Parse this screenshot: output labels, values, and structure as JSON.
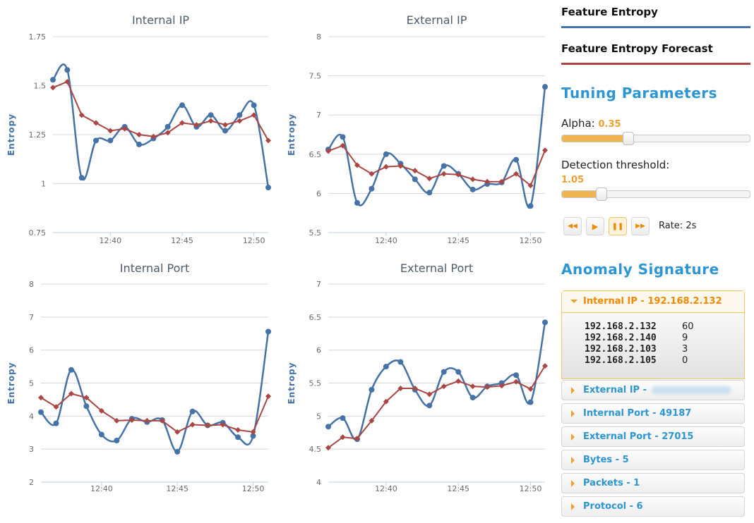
{
  "chart_data": [
    {
      "type": "line",
      "title": "Internal IP",
      "ylabel": "Entropy",
      "ylim": [
        0.75,
        1.75
      ],
      "yticks": [
        "0.75",
        "1",
        "1.25",
        "1.5",
        "1.75"
      ],
      "xticks": [
        "12:40",
        "12:45",
        "12:50"
      ],
      "xrange": [
        "12:36",
        "12:51"
      ],
      "x": [
        "12:36",
        "12:37",
        "12:38",
        "12:39",
        "12:40",
        "12:41",
        "12:42",
        "12:43",
        "12:44",
        "12:45",
        "12:46",
        "12:47",
        "12:48",
        "12:49",
        "12:50",
        "12:51"
      ],
      "series": [
        {
          "name": "Feature Entropy",
          "color": "#4572a7",
          "values": [
            1.53,
            1.58,
            1.03,
            1.22,
            1.22,
            1.29,
            1.2,
            1.23,
            1.29,
            1.4,
            1.29,
            1.35,
            1.27,
            1.35,
            1.4,
            0.98
          ]
        },
        {
          "name": "Feature Entropy Forecast",
          "color": "#aa4643",
          "values": [
            1.49,
            1.52,
            1.35,
            1.31,
            1.27,
            1.28,
            1.25,
            1.24,
            1.26,
            1.31,
            1.3,
            1.32,
            1.3,
            1.32,
            1.35,
            1.22
          ]
        }
      ]
    },
    {
      "type": "line",
      "title": "External IP",
      "ylabel": "Entropy",
      "ylim": [
        5.5,
        8
      ],
      "yticks": [
        "5.5",
        "6",
        "6.5",
        "7",
        "7.5",
        "8"
      ],
      "xticks": [
        "12:40",
        "12:45",
        "12:50"
      ],
      "xrange": [
        "12:36",
        "12:51"
      ],
      "x": [
        "12:36",
        "12:37",
        "12:38",
        "12:39",
        "12:40",
        "12:41",
        "12:42",
        "12:43",
        "12:44",
        "12:45",
        "12:46",
        "12:47",
        "12:48",
        "12:49",
        "12:50",
        "12:51"
      ],
      "series": [
        {
          "name": "Feature Entropy",
          "color": "#4572a7",
          "values": [
            6.56,
            6.72,
            5.88,
            6.06,
            6.5,
            6.38,
            6.18,
            6.01,
            6.35,
            6.25,
            6.05,
            6.12,
            6.14,
            6.43,
            5.84,
            7.36
          ]
        },
        {
          "name": "Feature Entropy Forecast",
          "color": "#aa4643",
          "values": [
            6.54,
            6.61,
            6.36,
            6.25,
            6.34,
            6.35,
            6.29,
            6.19,
            6.25,
            6.24,
            6.18,
            6.15,
            6.15,
            6.25,
            6.1,
            6.55
          ]
        }
      ]
    },
    {
      "type": "line",
      "title": "Internal Port",
      "ylabel": "Entropy",
      "ylim": [
        2,
        8
      ],
      "yticks": [
        "2",
        "3",
        "4",
        "5",
        "6",
        "7",
        "8"
      ],
      "xticks": [
        "12:40",
        "12:45",
        "12:50"
      ],
      "xrange": [
        "12:36",
        "12:51"
      ],
      "x": [
        "12:36",
        "12:37",
        "12:38",
        "12:39",
        "12:40",
        "12:41",
        "12:42",
        "12:43",
        "12:44",
        "12:45",
        "12:46",
        "12:47",
        "12:48",
        "12:49",
        "12:50",
        "12:51"
      ],
      "series": [
        {
          "name": "Feature Entropy",
          "color": "#4572a7",
          "values": [
            4.12,
            3.78,
            5.4,
            4.3,
            3.44,
            3.26,
            3.92,
            3.82,
            3.88,
            2.92,
            4.14,
            3.72,
            3.8,
            3.36,
            3.4,
            6.56
          ]
        },
        {
          "name": "Feature Entropy Forecast",
          "color": "#aa4643",
          "values": [
            4.56,
            4.28,
            4.68,
            4.56,
            4.16,
            3.86,
            3.88,
            3.86,
            3.86,
            3.52,
            3.74,
            3.72,
            3.74,
            3.58,
            3.52,
            4.6
          ]
        }
      ]
    },
    {
      "type": "line",
      "title": "External Port",
      "ylabel": "Entropy",
      "ylim": [
        4,
        7
      ],
      "yticks": [
        "4",
        "4.5",
        "5",
        "5.5",
        "6",
        "6.5",
        "7"
      ],
      "xticks": [
        "12:40",
        "12:45",
        "12:50"
      ],
      "xrange": [
        "12:36",
        "12:51"
      ],
      "x": [
        "12:36",
        "12:37",
        "12:38",
        "12:39",
        "12:40",
        "12:41",
        "12:42",
        "12:43",
        "12:44",
        "12:45",
        "12:46",
        "12:47",
        "12:48",
        "12:49",
        "12:50",
        "12:51"
      ],
      "series": [
        {
          "name": "Feature Entropy",
          "color": "#4572a7",
          "values": [
            4.84,
            4.97,
            4.65,
            5.4,
            5.75,
            5.82,
            5.4,
            5.16,
            5.67,
            5.67,
            5.28,
            5.45,
            5.5,
            5.62,
            5.21,
            6.42
          ]
        },
        {
          "name": "Feature Entropy Forecast",
          "color": "#aa4643",
          "values": [
            4.52,
            4.68,
            4.66,
            4.93,
            5.22,
            5.42,
            5.42,
            5.33,
            5.45,
            5.53,
            5.45,
            5.44,
            5.46,
            5.52,
            5.41,
            5.76
          ]
        }
      ]
    }
  ],
  "legend": {
    "entropy_label": "Feature Entropy",
    "entropy_color": "#4572a7",
    "forecast_label": "Feature Entropy Forecast",
    "forecast_color": "#aa4643"
  },
  "tuning": {
    "title": "Tuning Parameters",
    "alpha_label": "Alpha:",
    "alpha_value": "0.35",
    "alpha_fraction": 0.35,
    "threshold_label": "Detection threshold:",
    "threshold_value": "1.05",
    "threshold_fraction": 0.21,
    "rate_label": "Rate: 2s",
    "controls": {
      "rewind_icon": "rewind-icon",
      "play_icon": "play-icon",
      "pause_icon": "pause-icon",
      "forward_icon": "fast-forward-icon"
    }
  },
  "signature": {
    "title": "Anomaly Signature",
    "expanded": {
      "label": "Internal IP - 192.168.2.132",
      "rows": [
        {
          "ip": "192.168.2.132",
          "count": "60"
        },
        {
          "ip": "192.168.2.140",
          "count": "9"
        },
        {
          "ip": "192.168.2.103",
          "count": "3"
        },
        {
          "ip": "192.168.2.105",
          "count": "0"
        }
      ]
    },
    "items": [
      {
        "label": "External IP - "
      },
      {
        "label": "Internal Port - 49187"
      },
      {
        "label": "External Port - 27015"
      },
      {
        "label": "Bytes - 5"
      },
      {
        "label": "Packets - 1"
      },
      {
        "label": "Protocol - 6"
      }
    ]
  },
  "accent_color": "#f0a030",
  "heading_color": "#2d95d2"
}
